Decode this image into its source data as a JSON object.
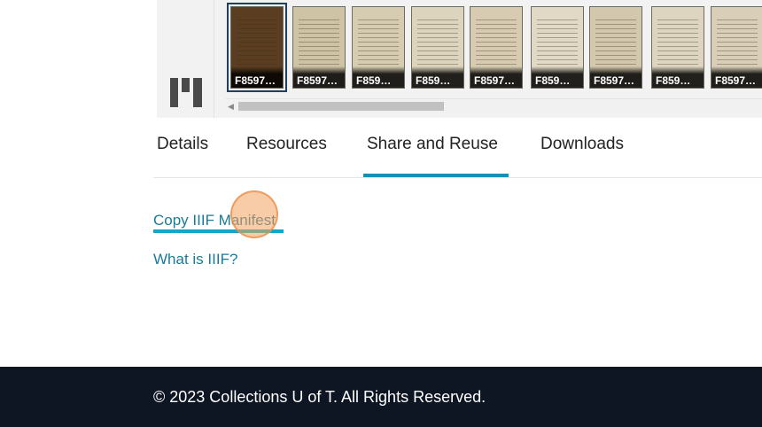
{
  "viewer": {
    "logo_icon": "mirador-logo-icon",
    "thumbnails": [
      {
        "label": "F8597…",
        "tone": "#5b3e22",
        "selected": true
      },
      {
        "label": "F8597…",
        "tone": "#cfc3a6",
        "selected": false
      },
      {
        "label": "F859…",
        "tone": "#d6ccb2",
        "selected": false
      },
      {
        "label": "F859…",
        "tone": "#ddd4bd",
        "selected": false
      },
      {
        "label": "F8597…",
        "tone": "#d7ccb1",
        "selected": false
      },
      {
        "label": "F859…",
        "tone": "#e1d9c5",
        "selected": false
      },
      {
        "label": "F8597…",
        "tone": "#d3c8ae",
        "selected": false
      },
      {
        "label": "F859…",
        "tone": "#ddd5c0",
        "selected": false
      },
      {
        "label": "F8597…",
        "tone": "#d9cfb8",
        "selected": false
      }
    ]
  },
  "tabs": [
    {
      "label": "Details"
    },
    {
      "label": "Resources"
    },
    {
      "label": "Share and Reuse",
      "active": true
    },
    {
      "label": "Downloads"
    }
  ],
  "links": {
    "copy_manifest": "Copy IIIF Manifest",
    "what_is_iiif": "What is IIIF?"
  },
  "footer": {
    "copyright": "© 2023 Collections U of T. All Rights Reserved."
  },
  "colors": {
    "accent": "#1591b3",
    "link": "#1a7a98",
    "footer_bg": "#0f1623"
  }
}
